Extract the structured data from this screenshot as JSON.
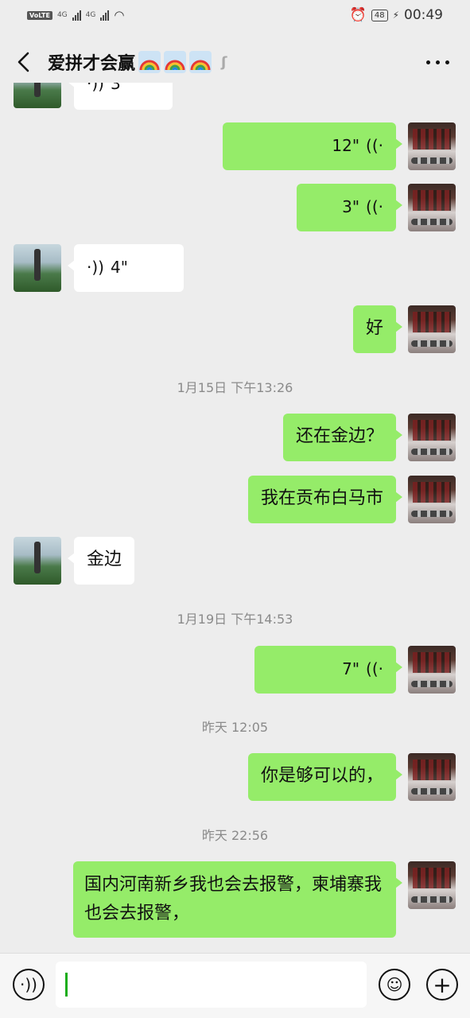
{
  "status_bar": {
    "volte": "VoLTE",
    "net1": "4G",
    "net2": "4G",
    "battery": "48",
    "time": "00:49"
  },
  "header": {
    "title": "爱拼才会赢",
    "back_icon": "chevron-left-icon",
    "more_icon": "more-dots-icon",
    "ear_icon": "earpiece-icon"
  },
  "messages": [
    {
      "side": "them",
      "type": "voice",
      "text": "3\""
    },
    {
      "side": "me",
      "type": "voice",
      "text": "12\""
    },
    {
      "side": "me",
      "type": "voice",
      "text": "3\""
    },
    {
      "side": "them",
      "type": "voice",
      "text": "4\""
    },
    {
      "side": "me",
      "type": "text",
      "text": "好"
    },
    {
      "type": "time",
      "text": "1月15日 下午13:26"
    },
    {
      "side": "me",
      "type": "text",
      "text": "还在金边？"
    },
    {
      "side": "me",
      "type": "text",
      "text": "我在贡布白马市"
    },
    {
      "side": "them",
      "type": "text",
      "text": "金边"
    },
    {
      "type": "time",
      "text": "1月19日 下午14:53"
    },
    {
      "side": "me",
      "type": "voice",
      "text": "7\""
    },
    {
      "type": "time",
      "text": "昨天 12:05"
    },
    {
      "side": "me",
      "type": "text",
      "text": "你是够可以的，"
    },
    {
      "type": "time",
      "text": "昨天 22:56"
    },
    {
      "side": "me",
      "type": "text",
      "text": "国内河南新乡我也会去报警，柬埔寨我也会去报警，"
    }
  ],
  "input_bar": {
    "voice_icon": "voice-input-icon",
    "emoji_icon": "emoji-icon",
    "plus_icon": "plus-icon",
    "value": ""
  },
  "colors": {
    "sent_bubble": "#95ec69",
    "received_bubble": "#ffffff",
    "background": "#ededed",
    "cursor": "#1aad19"
  }
}
